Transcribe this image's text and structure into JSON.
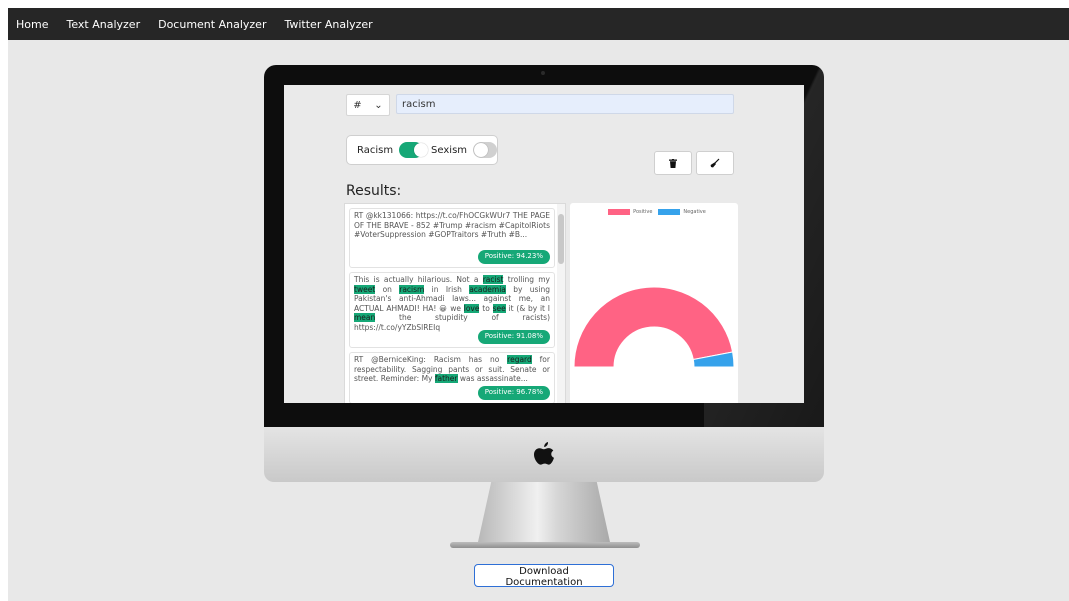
{
  "nav": {
    "items": [
      "Home",
      "Text Analyzer",
      "Document Analyzer",
      "Twitter Analyzer"
    ]
  },
  "search": {
    "hash_symbol": "#",
    "chevron": "⌄",
    "query": "racism"
  },
  "toggles": {
    "racism": {
      "label": "Racism",
      "on": true
    },
    "sexism": {
      "label": "Sexism",
      "on": false
    }
  },
  "toolbar": {
    "delete_icon": "trash-icon",
    "clean_icon": "broom-icon"
  },
  "results": {
    "title": "Results:",
    "tweets": [
      {
        "text": "RT @kk131066: https://t.co/FhOCGkWUr7 THE PAGE OF THE BRAVE - 852 #Trump #racism #CapitolRiots #VoterSuppression #GOPTraitors #Truth #B...",
        "badge": "Positive: 94.23%"
      },
      {
        "segments": [
          {
            "t": "This is actually hilarious. Not a ",
            "h": false
          },
          {
            "t": "racist",
            "h": true
          },
          {
            "t": " trolling my ",
            "h": false
          },
          {
            "t": "tweet",
            "h": true
          },
          {
            "t": " on ",
            "h": false
          },
          {
            "t": "racism",
            "h": true
          },
          {
            "t": " in Irish ",
            "h": false
          },
          {
            "t": "academia",
            "h": true
          },
          {
            "t": " by using Pakistan's anti-Ahmadi laws... against me, an ACTUAL AHMADI! HA! 😀 we ",
            "h": false
          },
          {
            "t": "love",
            "h": true
          },
          {
            "t": " to ",
            "h": false
          },
          {
            "t": "see",
            "h": true
          },
          {
            "t": " it (& by it I ",
            "h": false
          },
          {
            "t": "mean",
            "h": true
          },
          {
            "t": " the stupidity of racists) https://t.co/yYZbSlREIq",
            "h": false
          }
        ],
        "badge": "Positive: 91.08%"
      },
      {
        "segments": [
          {
            "t": "RT @BerniceKing: Racism has no ",
            "h": false
          },
          {
            "t": "regard",
            "h": true
          },
          {
            "t": " for respectability. Sagging pants or suit. Senate or street. Reminder: My ",
            "h": false
          },
          {
            "t": "father",
            "h": true
          },
          {
            "t": " was assassinate...",
            "h": false
          }
        ],
        "badge": "Positive: 96.78%"
      }
    ]
  },
  "chart_data": {
    "type": "pie",
    "variant": "half-doughnut",
    "labels": [
      "Positive",
      "Negative"
    ],
    "values": [
      94,
      6
    ],
    "colors": [
      "#ff6384",
      "#36a2eb"
    ],
    "legend": "top"
  },
  "footer": {
    "download_label": "Download Documentation"
  }
}
